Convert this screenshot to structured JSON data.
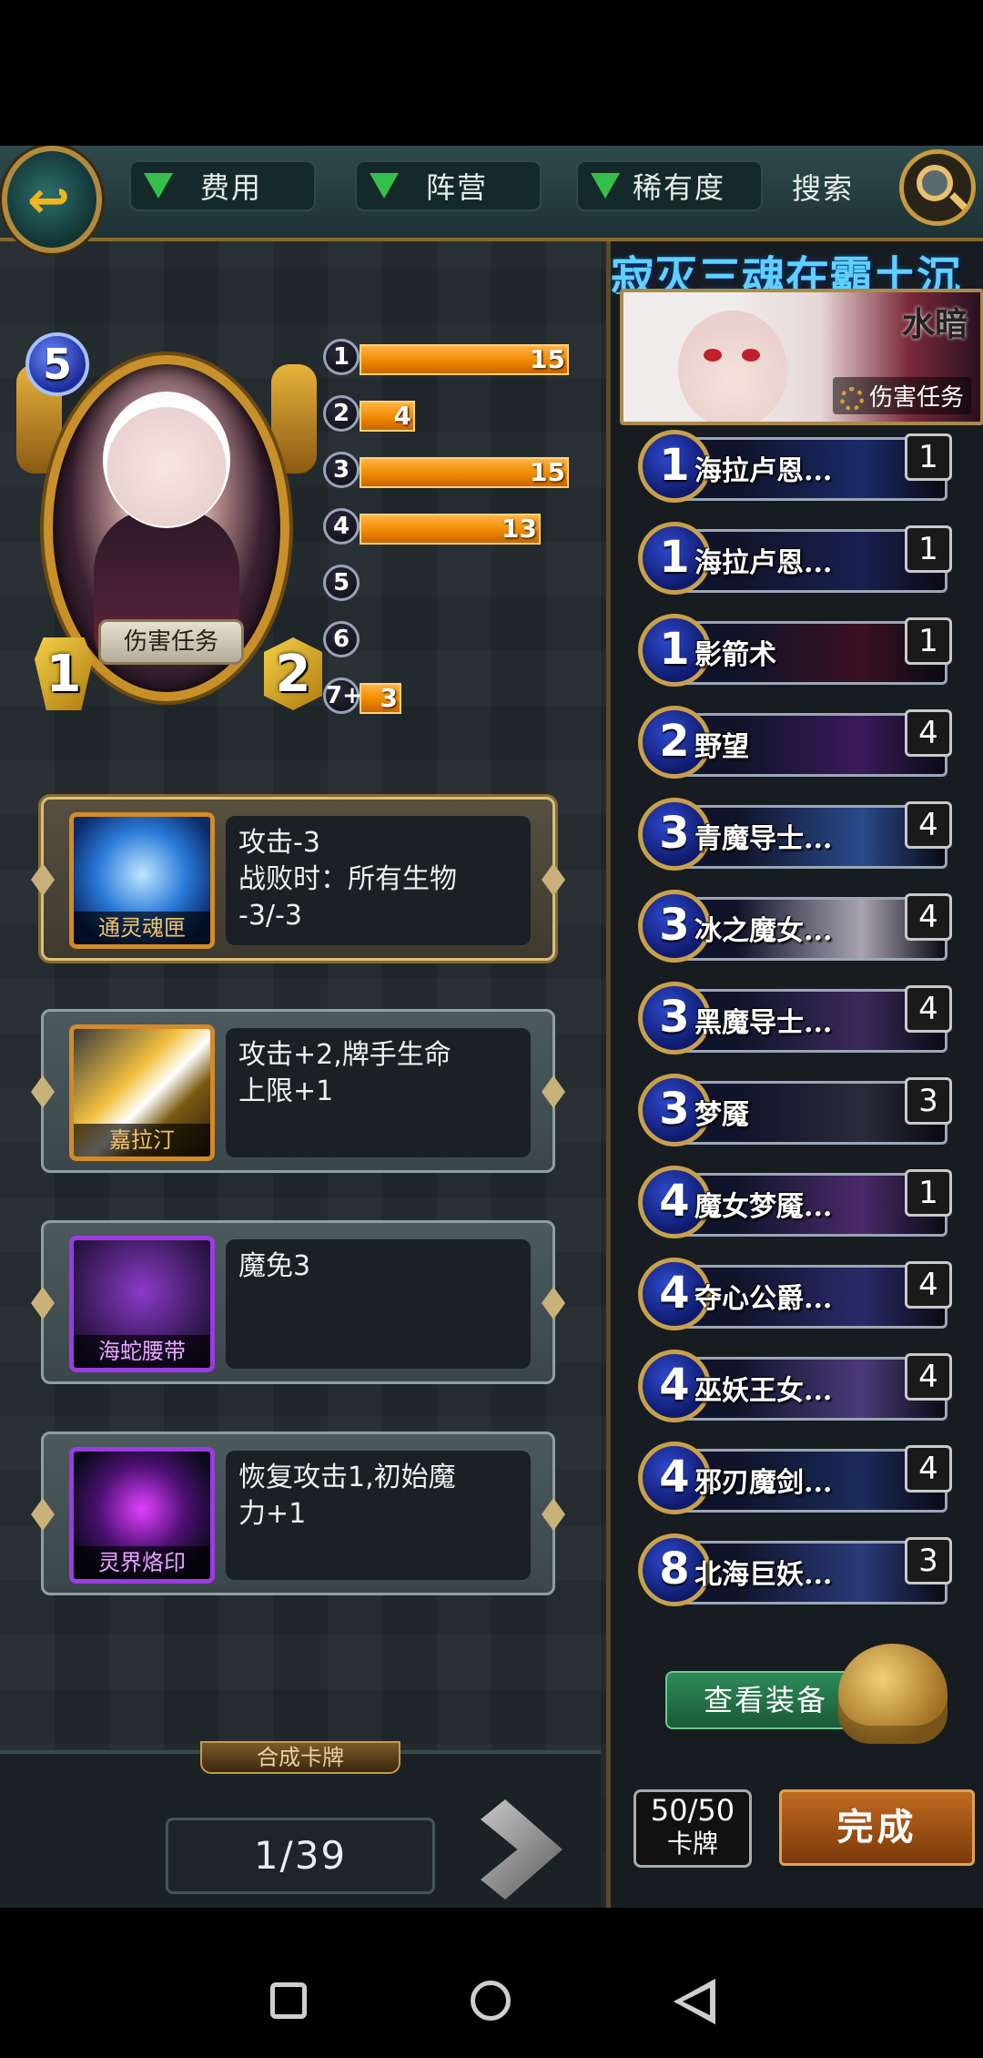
{
  "topbar": {
    "filters": [
      "费用",
      "阵营",
      "稀有度"
    ],
    "search_label": "搜索"
  },
  "hero": {
    "cost": "5",
    "banner": "伤害任务",
    "attack": "1",
    "health": "2"
  },
  "mana_curve": [
    {
      "cost": "1",
      "count": 15
    },
    {
      "cost": "2",
      "count": 4
    },
    {
      "cost": "3",
      "count": 15
    },
    {
      "cost": "4",
      "count": 13
    },
    {
      "cost": "5",
      "count": null
    },
    {
      "cost": "6",
      "count": null
    },
    {
      "cost": "7+",
      "count": 3
    }
  ],
  "equipment": [
    {
      "name": "通灵魂匣",
      "desc": "攻击-3\n战败时：所有生物\n-3/-3",
      "icon": "blue-cube-icon"
    },
    {
      "name": "嘉拉汀",
      "desc": "攻击+2,牌手生命\n上限+1",
      "icon": "sword-icon"
    },
    {
      "name": "海蛇腰带",
      "desc": "魔免3",
      "icon": "belt-icon"
    },
    {
      "name": "灵界烙印",
      "desc": "恢复攻击1,初始魔\n力+1",
      "icon": "brand-sigil-icon"
    }
  ],
  "bottom": {
    "synth_tab": "合成卡牌",
    "page": "1/39"
  },
  "deck": {
    "title": "寂灭三魂在霸土沉",
    "faction": "水暗",
    "task": "伤害任务",
    "cards": [
      {
        "cost": "1",
        "name": "海拉卢恩...",
        "count": "1",
        "color": "#1a2a6a"
      },
      {
        "cost": "1",
        "name": "海拉卢恩...",
        "count": "1",
        "color": "#1a2050"
      },
      {
        "cost": "1",
        "name": "影箭术",
        "count": "1",
        "color": "#3a1020"
      },
      {
        "cost": "2",
        "name": "野望",
        "count": "4",
        "color": "#3a1a5a"
      },
      {
        "cost": "3",
        "name": "青魔导士...",
        "count": "4",
        "color": "#2a4a8a"
      },
      {
        "cost": "3",
        "name": "冰之魔女...",
        "count": "4",
        "color": "#a8a4b0"
      },
      {
        "cost": "3",
        "name": "黑魔导士...",
        "count": "4",
        "color": "#3a2a5a"
      },
      {
        "cost": "3",
        "name": "梦魇",
        "count": "3",
        "color": "#2a2a3a"
      },
      {
        "cost": "4",
        "name": "魔女梦魇...",
        "count": "1",
        "color": "#4a2a6a"
      },
      {
        "cost": "4",
        "name": "夺心公爵...",
        "count": "4",
        "color": "#2a2a6a"
      },
      {
        "cost": "4",
        "name": "巫妖王女...",
        "count": "4",
        "color": "#4a3a7a"
      },
      {
        "cost": "4",
        "name": "邪刃魔剑...",
        "count": "4",
        "color": "#1a2a5a"
      },
      {
        "cost": "8",
        "name": "北海巨妖...",
        "count": "3",
        "color": "#2a3a7a"
      }
    ],
    "view_equipment": "查看装备",
    "card_count": "50/50",
    "card_unit": "卡牌",
    "done": "完成"
  }
}
